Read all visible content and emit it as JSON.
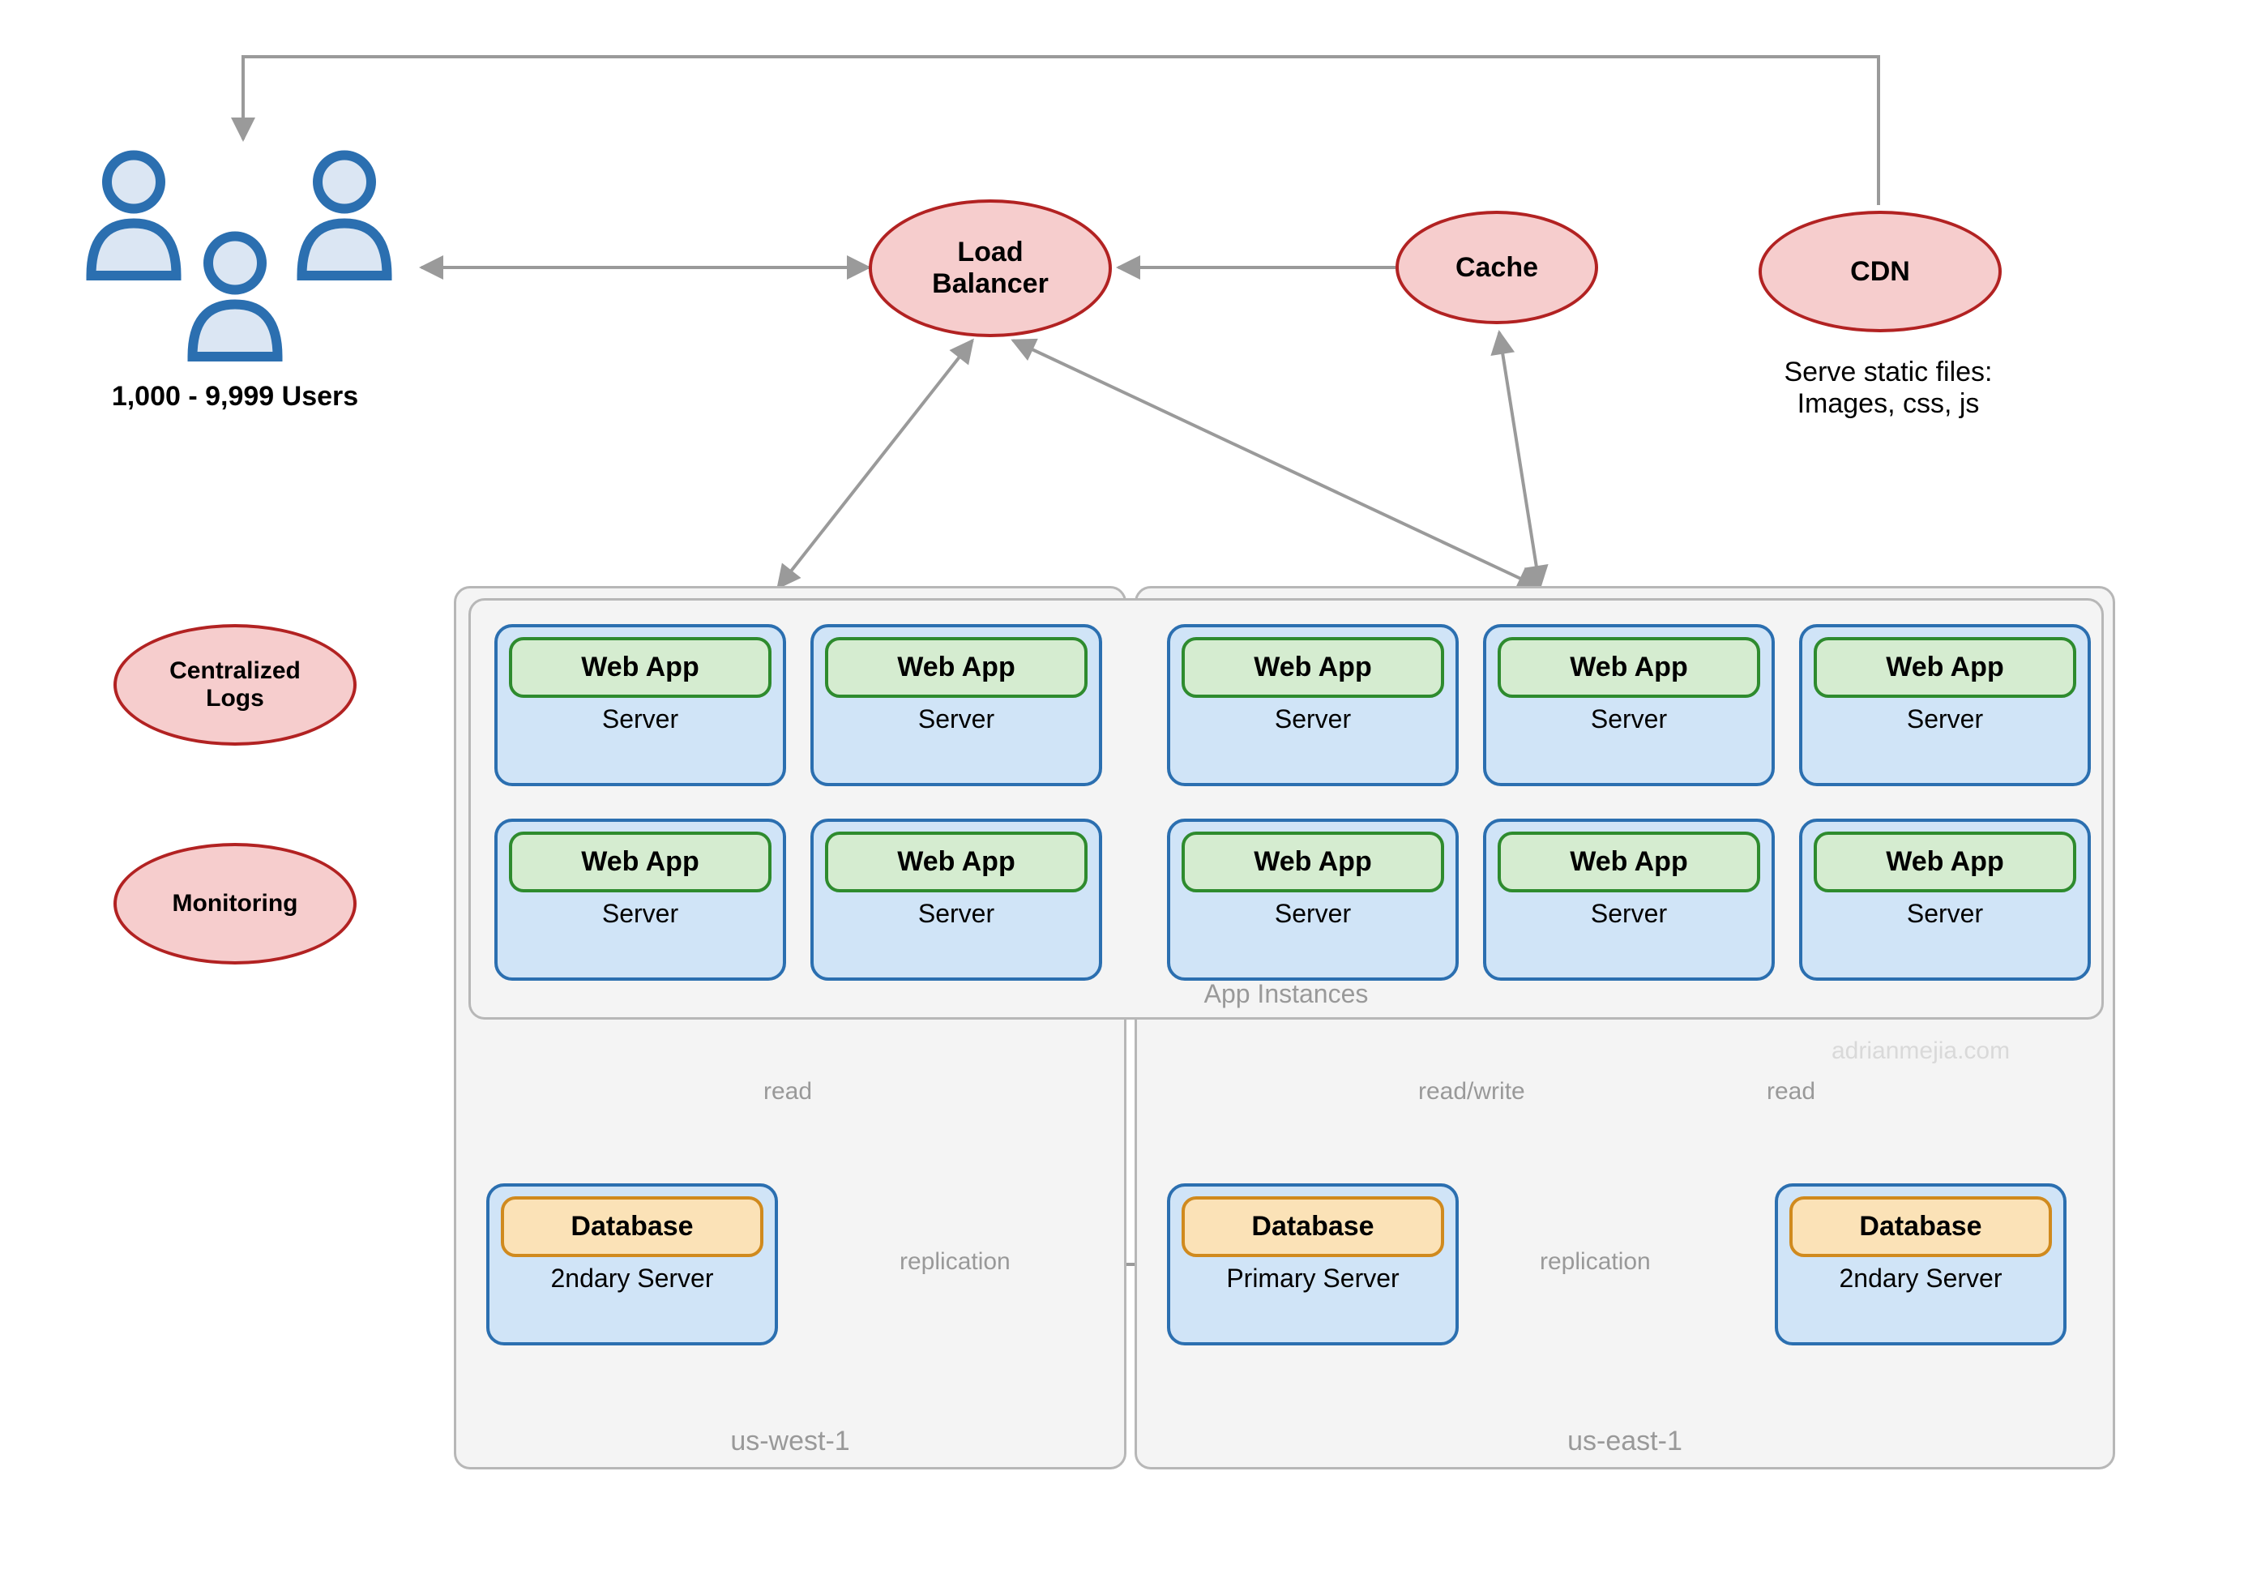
{
  "users": {
    "caption": "1,000 - 9,999 Users"
  },
  "nodes": {
    "load_balancer": "Load\nBalancer",
    "cache": "Cache",
    "cdn": "CDN",
    "cdn_caption": "Serve static files:\nImages, css, js",
    "centralized_logs": "Centralized\nLogs",
    "monitoring": "Monitoring"
  },
  "server": {
    "webapp_label": "Web App",
    "server_label": "Server",
    "database_label": "Database",
    "db_secondary_label": "2ndary Server",
    "db_primary_label": "Primary Server"
  },
  "regions": {
    "west": "us-west-1",
    "east": "us-east-1",
    "app_instances": "App Instances"
  },
  "edges": {
    "read": "read",
    "readwrite": "read/write",
    "replication": "replication"
  },
  "watermark": "adrianmejia.com"
}
